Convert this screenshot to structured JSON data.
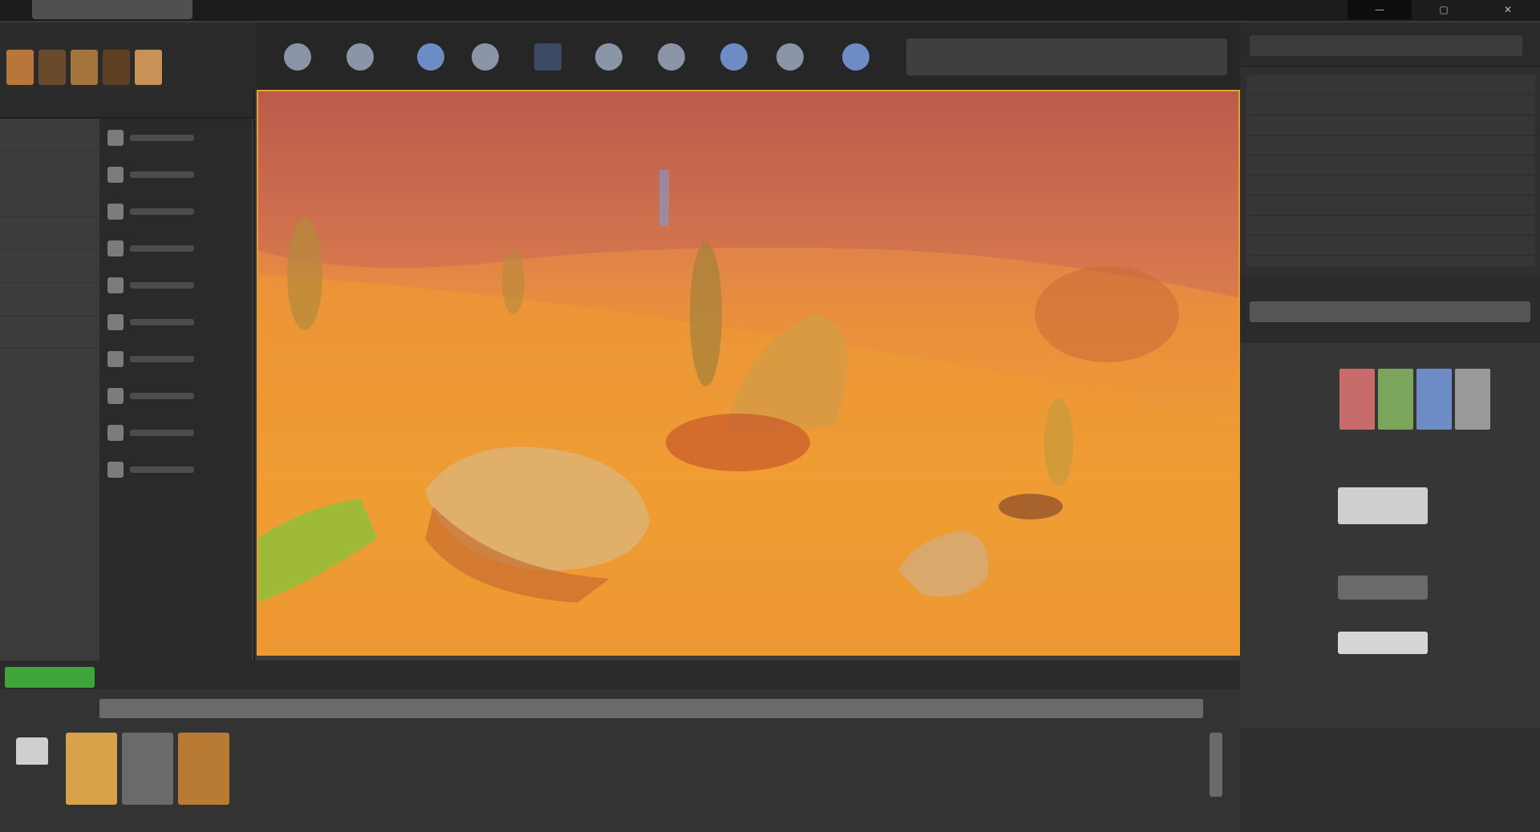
{
  "window": {
    "tab_title": "",
    "min_glyph": "—",
    "max_glyph": "▢",
    "close_glyph": "✕"
  },
  "modes": {
    "icons": [
      "place-mode-icon",
      "paint-mode-icon",
      "landscape-mode-icon",
      "foliage-mode-icon",
      "mesh-paint-icon"
    ]
  },
  "toolbar": {
    "buttons": [
      "save-current-icon",
      "source-control-icon",
      "content-icon",
      "marketplace-icon",
      "settings-icon",
      "blueprints-icon",
      "cinematics-icon",
      "build-icon",
      "play-icon",
      "launch-icon"
    ]
  },
  "content_browser": {
    "add_new_label": "",
    "items": [
      {
        "label": ""
      },
      {
        "label": ""
      },
      {
        "label": ""
      }
    ]
  },
  "colors": {
    "accent": "#e6a030",
    "add_button": "#3fa53b",
    "x_axis": "#c76b6b",
    "y_axis": "#7aa55a",
    "z_axis": "#6d8bc5"
  }
}
